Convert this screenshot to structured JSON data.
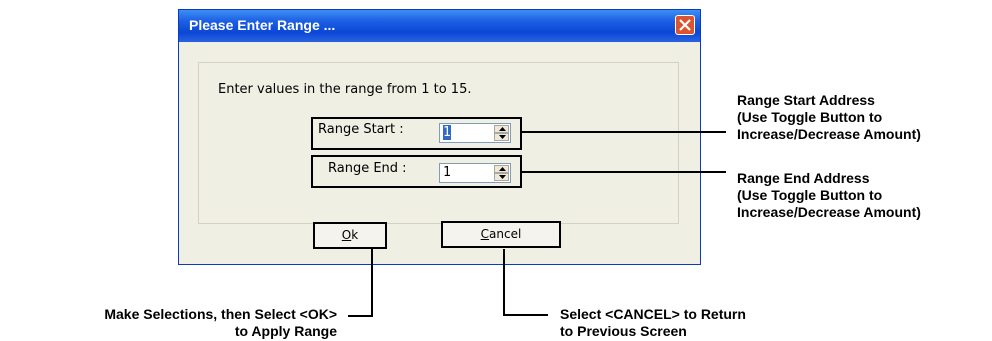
{
  "dialog": {
    "title": "Please Enter Range ...",
    "prompt": "Enter values in the range from 1 to 15.",
    "range_start": {
      "label": "Range Start :",
      "value": "1"
    },
    "range_end": {
      "label": "Range End :",
      "value": "1"
    },
    "ok": {
      "mnemonic": "O",
      "rest": "k"
    },
    "cancel": {
      "mnemonic": "C",
      "rest": "ancel"
    }
  },
  "annotations": {
    "range_start": [
      "Range Start Address",
      "(Use Toggle Button to",
      "Increase/Decrease Amount)"
    ],
    "range_end": [
      "Range End Address",
      "(Use Toggle Button to",
      "Increase/Decrease Amount)"
    ],
    "ok": [
      "Make Selections, then Select <OK>",
      "to Apply Range"
    ],
    "cancel": [
      "Select <CANCEL> to Return",
      "to Previous Screen"
    ]
  },
  "colors": {
    "titlebar": "#0a47d6",
    "close_button": "#d9542f",
    "dialog_bg": "#f0efe4",
    "selection": "#316ac5"
  }
}
